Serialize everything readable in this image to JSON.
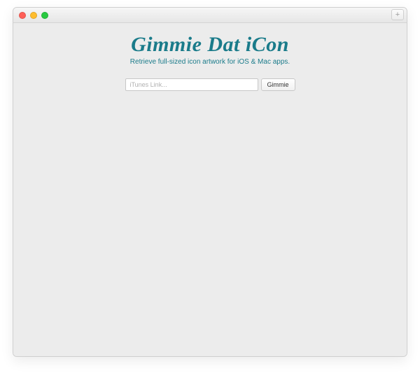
{
  "window": {
    "new_tab_glyph": "+"
  },
  "header": {
    "title": "Gimmie Dat iCon",
    "subtitle": "Retrieve full-sized icon artwork for iOS & Mac apps."
  },
  "form": {
    "input_placeholder": "iTunes Link...",
    "input_value": "",
    "button_label": "Gimmie"
  },
  "colors": {
    "accent": "#1a7b8a",
    "window_bg": "#ececec"
  }
}
